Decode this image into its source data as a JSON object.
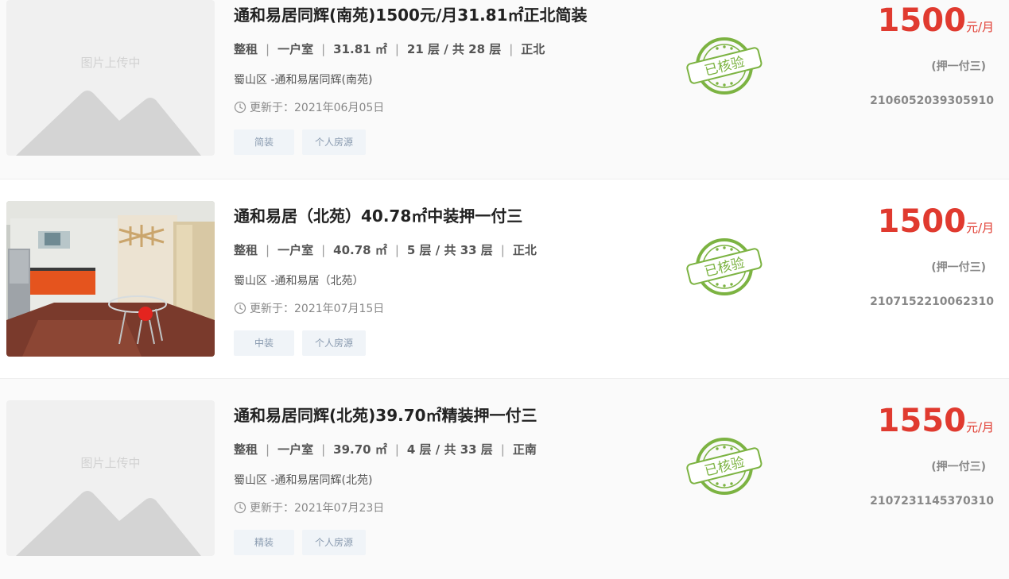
{
  "placeholder_text": "图片上传中",
  "listings": [
    {
      "title": "通和易居同辉(南苑)1500元/月31.81㎡正北简装",
      "rent_type": "整租",
      "layout": "一户室",
      "area": "31.81 ㎡",
      "floor": "21 层 / 共 28 层",
      "orientation": "正北",
      "address": "蜀山区 -通和易居同辉(南苑)",
      "updated": "更新于：2021年06月05日",
      "tags": [
        "简装",
        "个人房源"
      ],
      "verified_stamp": "已核验",
      "price": "1500",
      "price_unit": "元/月",
      "deposit": "(押一付三)",
      "code": "2106052039305910",
      "has_photo": false
    },
    {
      "title": "通和易居（北苑）40.78㎡中装押一付三",
      "rent_type": "整租",
      "layout": "一户室",
      "area": "40.78 ㎡",
      "floor": "5 层 / 共 33 层",
      "orientation": "正北",
      "address": "蜀山区 -通和易居（北苑）",
      "updated": "更新于：2021年07月15日",
      "tags": [
        "中装",
        "个人房源"
      ],
      "verified_stamp": "已核验",
      "price": "1500",
      "price_unit": "元/月",
      "deposit": "(押一付三)",
      "code": "2107152210062310",
      "has_photo": true
    },
    {
      "title": "通和易居同辉(北苑)39.70㎡精装押一付三",
      "rent_type": "整租",
      "layout": "一户室",
      "area": "39.70 ㎡",
      "floor": "4 层 / 共 33 层",
      "orientation": "正南",
      "address": "蜀山区 -通和易居同辉(北苑)",
      "updated": "更新于：2021年07月23日",
      "tags": [
        "精装",
        "个人房源"
      ],
      "verified_stamp": "已核验",
      "price": "1550",
      "price_unit": "元/月",
      "deposit": "(押一付三)",
      "code": "2107231145370310",
      "has_photo": false
    }
  ],
  "colors": {
    "price": "#e03a2f",
    "stamp": "#7cb342",
    "tag_text": "#8a9bb0",
    "tag_bg": "#f0f4f8"
  }
}
